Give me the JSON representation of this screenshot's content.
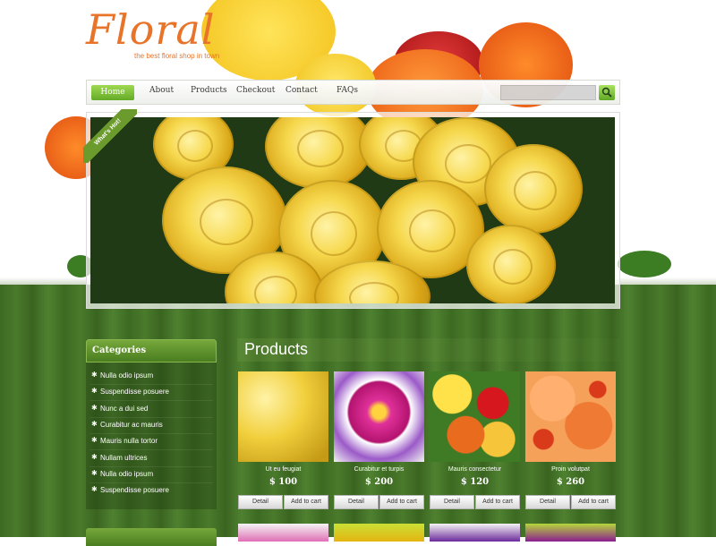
{
  "brand": {
    "name": "Floral",
    "tagline": "the best floral shop in town"
  },
  "nav": {
    "items": [
      "Home",
      "About",
      "Products",
      "Checkout",
      "Contact",
      "FAQs"
    ],
    "search_placeholder": ""
  },
  "banner": {
    "ribbon": "What's Hot!"
  },
  "sidebar": {
    "title": "Categories",
    "items": [
      "Nulla odio ipsum",
      "Suspendisse posuere",
      "Nunc a dui sed",
      "Curabitur ac mauris",
      "Mauris nulla tortor",
      "Nullam ultrices",
      "Nulla odio ipsum",
      "Suspendisse posuere"
    ]
  },
  "products": {
    "title": "Products",
    "items": [
      {
        "name": "Ut eu feugiat",
        "price": "$ 100",
        "detail": "Detail",
        "cart": "Add to cart",
        "color": "#f1cf3c"
      },
      {
        "name": "Curabitur et turpis",
        "price": "$ 200",
        "detail": "Detail",
        "cart": "Add to cart",
        "color": "#e0319a"
      },
      {
        "name": "Mauris consectetur",
        "price": "$ 120",
        "detail": "Detail",
        "cart": "Add to cart",
        "color": "#e86b1e"
      },
      {
        "name": "Proin volutpat",
        "price": "$ 260",
        "detail": "Detail",
        "cart": "Add to cart",
        "color": "#ef7a34"
      }
    ]
  },
  "colors": {
    "accent_green": "#5fa81f",
    "logo_orange": "#e8742a"
  }
}
